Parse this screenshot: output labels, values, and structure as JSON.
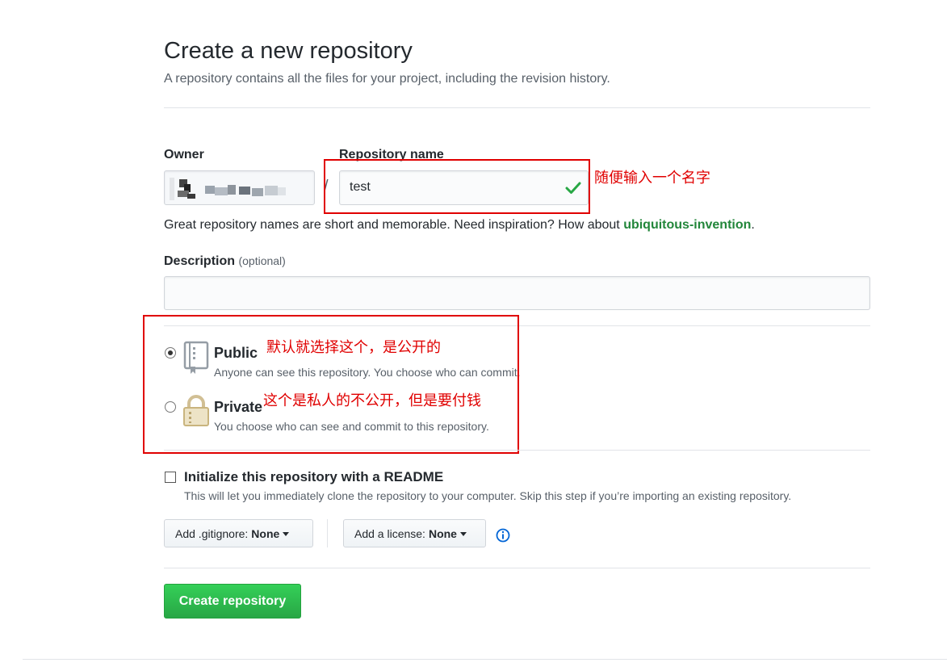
{
  "header": {
    "title": "Create a new repository",
    "subtitle": "A repository contains all the files for your project, including the revision history."
  },
  "owner": {
    "label": "Owner"
  },
  "repo": {
    "label": "Repository name",
    "value": "test",
    "separator": "/",
    "valid_icon": "check-icon"
  },
  "inspiration": {
    "text": "Great repository names are short and memorable. Need inspiration? How about ",
    "suggestion": "ubiquitous-invention",
    "end": "."
  },
  "description": {
    "label": "Description",
    "optional": "(optional)",
    "value": ""
  },
  "visibility": {
    "public": {
      "title": "Public",
      "desc": "Anyone can see this repository. You choose who can commit.",
      "icon": "repo-book-icon",
      "selected": true
    },
    "private": {
      "title": "Private",
      "desc": "You choose who can see and commit to this repository.",
      "icon": "lock-icon",
      "selected": false
    }
  },
  "readme": {
    "title": "Initialize this repository with a README",
    "desc": "This will let you immediately clone the repository to your computer. Skip this step if you’re importing an existing repository.",
    "checked": false
  },
  "gitignore": {
    "label": "Add .gitignore:",
    "value": "None"
  },
  "license": {
    "label": "Add a license:",
    "value": "None",
    "info_icon": "info-icon"
  },
  "submit": {
    "label": "Create repository"
  },
  "annotations": {
    "name_note": "随便输入一个名字",
    "public_note": "默认就选择这个，是公开的",
    "private_note": "这个是私人的不公开，但是要付钱"
  },
  "colors": {
    "accent_green": "#28a745",
    "annotation_red": "#e00000",
    "suggestion_green": "#22863a",
    "info_blue": "#0366d6"
  }
}
